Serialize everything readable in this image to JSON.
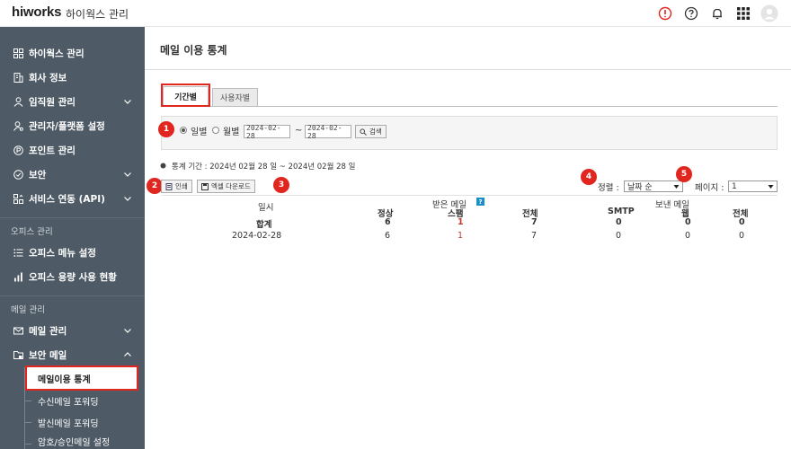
{
  "topbar": {
    "brand": "hiworks",
    "brand_sub": "하이웍스 관리"
  },
  "sidebar": {
    "items": [
      {
        "label": "하이웍스 관리",
        "icon": "grid-icon"
      },
      {
        "label": "회사 정보",
        "icon": "building-icon"
      },
      {
        "label": "임직원 관리",
        "icon": "person-icon"
      },
      {
        "label": "관리자/플랫폼 설정",
        "icon": "admin-person-icon"
      },
      {
        "label": "포인트 관리",
        "icon": "point-icon"
      },
      {
        "label": "보안",
        "icon": "shield-icon"
      },
      {
        "label": "서비스 연동 (API)",
        "icon": "api-icon"
      }
    ],
    "section_office": "오피스 관리",
    "office_items": [
      {
        "label": "오피스 메뉴 설정",
        "icon": "menu-list-icon"
      },
      {
        "label": "오피스 용량 사용 현황",
        "icon": "bar-chart-icon"
      }
    ],
    "section_mail": "메일 관리",
    "mail_items": [
      {
        "label": "메일 관리",
        "icon": "mail-icon"
      },
      {
        "label": "보안 메일",
        "icon": "secure-mail-icon"
      }
    ],
    "secure_mail_sub": [
      "메일이용 통계",
      "수신메일 포워딩",
      "발신메일 포워딩",
      "암호/승인메일 설정"
    ]
  },
  "main": {
    "title": "메일 이용 통계",
    "tabs": [
      "기간별",
      "사용자별"
    ],
    "filter": {
      "daily": "일별",
      "monthly": "월별",
      "date_from": "2024-02-28",
      "separator": "~",
      "date_to": "2024-02-28",
      "search_label": "검색"
    },
    "period_text": "통계 기간 : 2024년 02월 28 일 ~ 2024년 02월 28 일",
    "print_label": "인쇄",
    "excel_label": "엑셀 다운로드",
    "sort_label": "정렬 :",
    "sort_value": "날짜 순",
    "page_label": "페이지 :",
    "page_value": "1",
    "badges": [
      "1",
      "2",
      "3",
      "4",
      "5"
    ],
    "table": {
      "col_date": "일시",
      "group_received": "받은 메일",
      "group_sent": "보낸 메일",
      "help_mark": "?",
      "sub_cols": [
        "정상",
        "스팸",
        "전체",
        "SMTP",
        "웹",
        "전체"
      ],
      "rows": [
        {
          "date": "합계",
          "values": [
            "6",
            "1",
            "7",
            "0",
            "0",
            "0"
          ]
        },
        {
          "date": "2024-02-28",
          "values": [
            "6",
            "1",
            "7",
            "0",
            "0",
            "0"
          ]
        }
      ]
    }
  },
  "colors": {
    "sidebar_bg": "#4e5a65",
    "highlight_red": "#e0261f",
    "spam_red": "#c0392b",
    "help_blue": "#1a8fc9"
  }
}
